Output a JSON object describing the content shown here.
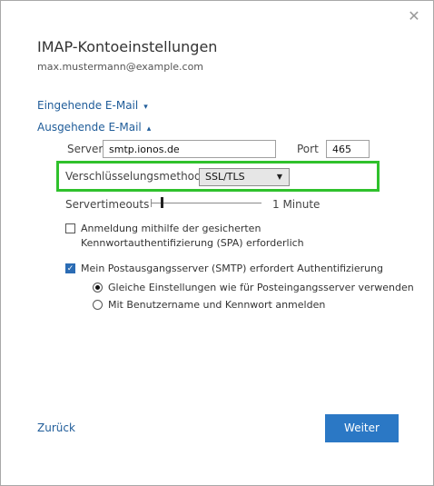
{
  "dialog": {
    "title": "IMAP-Kontoeinstellungen",
    "account": "max.mustermann@example.com",
    "close_glyph": "✕"
  },
  "incoming": {
    "label": "Eingehende E-Mail",
    "chevron": "▾",
    "expanded": false
  },
  "outgoing": {
    "label": "Ausgehende E-Mail",
    "chevron": "▴",
    "expanded": true,
    "server_label": "Server",
    "server_value": "smtp.ionos.de",
    "port_label": "Port",
    "port_value": "465",
    "encryption_label": "Verschlüsselungsmethode",
    "encryption_value": "SSL/TLS",
    "encryption_caret": "▼",
    "timeout_label": "Servertimeouts",
    "timeout_value": "1 Minute",
    "spa_label": "Anmeldung mithilfe der gesicherten Kennwortauthentifizierung (SPA) erforderlich",
    "spa_checked": false,
    "auth_label": "Mein Postausgangsserver (SMTP) erfordert Authentifizierung",
    "auth_checked": true,
    "auth_checkmark": "✓",
    "auth_options": [
      {
        "label": "Gleiche Einstellungen wie für Posteingangsserver verwenden",
        "selected": true
      },
      {
        "label": "Mit Benutzername und Kennwort anmelden",
        "selected": false
      }
    ]
  },
  "footer": {
    "back_label": "Zurück",
    "next_label": "Weiter"
  },
  "colors": {
    "accent": "#2b78c5",
    "link": "#1f5c99",
    "highlight": "#2fc12c"
  },
  "icons": {
    "close": "close-icon",
    "incoming_chevron": "chevron-down-icon",
    "outgoing_chevron": "chevron-up-icon",
    "select_caret": "caret-down-icon",
    "checkmark": "checkmark-icon"
  }
}
